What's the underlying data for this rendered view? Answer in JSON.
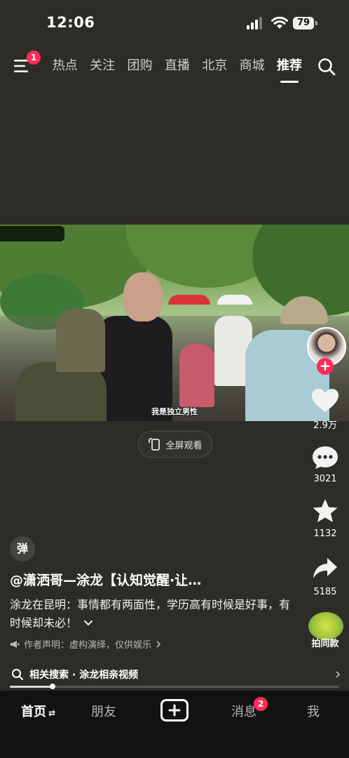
{
  "status_bar": {
    "time": "12:06",
    "battery": "79"
  },
  "top_nav": {
    "menu_badge": "1",
    "tabs": [
      "热点",
      "关注",
      "团购",
      "直播",
      "北京",
      "商城",
      "推荐"
    ],
    "active_tab": "推荐"
  },
  "video": {
    "subtitle": "我是独立男性",
    "fullscreen_label": "全屏观看"
  },
  "right_rail": {
    "likes": "2.9万",
    "comments": "3021",
    "favorites": "1132",
    "shares": "5185",
    "product_label": "拍同款"
  },
  "post": {
    "danmu_label": "弹",
    "author": "@潇洒哥—涂龙【认知觉醒·让…",
    "caption": "涂龙在昆明：事情都有两面性，学历高有时候是好事，有时候却未必！",
    "disclaimer": "作者声明：虚构演绎，仅供娱乐",
    "related_search": "相关搜索 · 涂龙相亲视频",
    "progress": 0.13
  },
  "bottom_nav": {
    "home": "首页",
    "friends": "朋友",
    "messages": "消息",
    "messages_badge": "2",
    "me": "我"
  },
  "colors": {
    "accent": "#fe2c55",
    "background": "#2e2c27",
    "nav_background": "#121212"
  }
}
